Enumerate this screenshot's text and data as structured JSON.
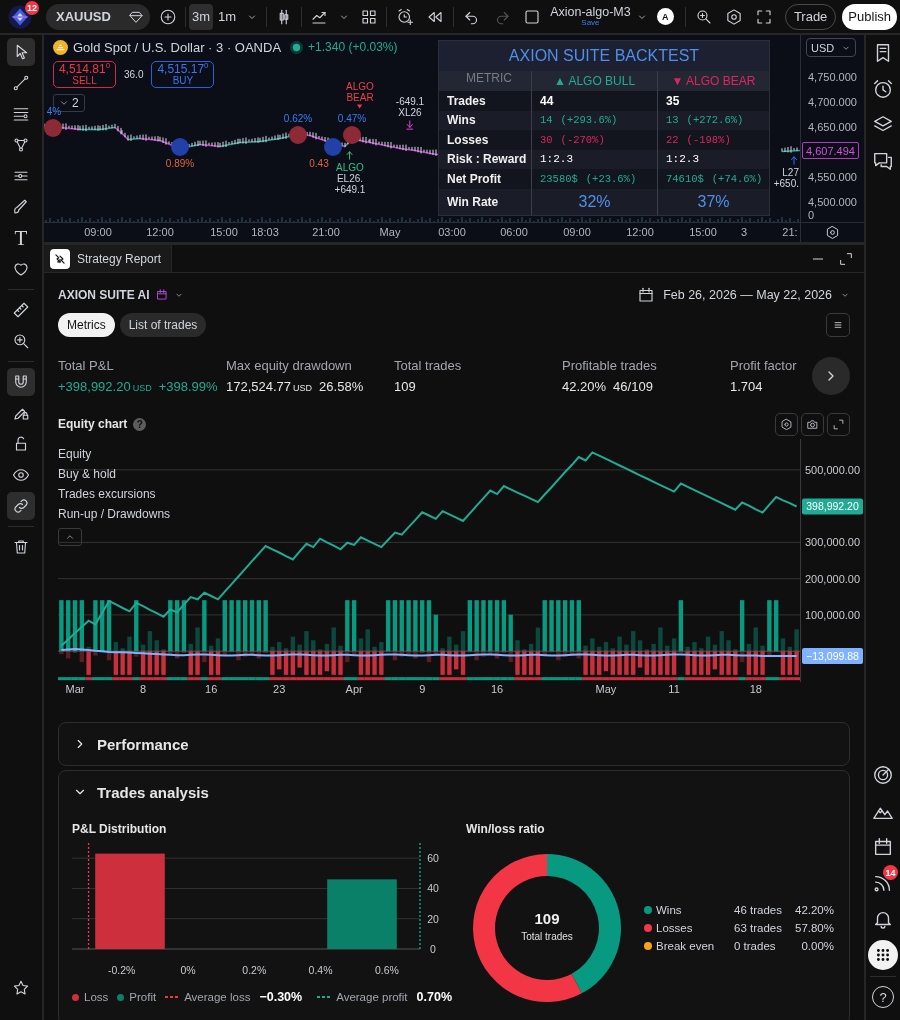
{
  "toolbar": {
    "notifications": "12",
    "symbol": "XAUUSD",
    "intervals": [
      {
        "label": "3m",
        "selected": true
      },
      {
        "label": "1m",
        "selected": false
      }
    ],
    "undo_enabled": true,
    "redo_enabled": false,
    "layout": {
      "name": "Axion-algo-M3",
      "status": "Save"
    },
    "avatar": "A",
    "actions": [
      {
        "label": "Trade",
        "kind": "outline"
      },
      {
        "label": "Publish",
        "kind": "primary"
      }
    ]
  },
  "drawing_tools": [
    {
      "selected": true
    },
    {
      "selected": false
    },
    {
      "selected": false
    },
    {
      "selected": false
    },
    {
      "selected": false
    },
    {
      "selected": false
    },
    {
      "selected": false,
      "glyph": "T"
    },
    {
      "selected": false
    },
    {
      "selected": false
    },
    {
      "selected": false
    },
    {
      "selected": true
    },
    {
      "selected": false
    },
    {
      "selected": false
    },
    {
      "selected": false
    },
    {
      "selected": true
    },
    {
      "selected": false
    },
    {
      "selected": false
    }
  ],
  "side_panel": [
    {
      "selected": false
    },
    {
      "selected": false
    },
    {
      "selected": false
    },
    {
      "selected": false
    },
    {
      "selected": false
    },
    {
      "selected": false
    },
    {
      "selected": false
    },
    {
      "selected": false,
      "badge": "14"
    },
    {
      "selected": false
    },
    {
      "selected": true
    },
    {
      "selected": false,
      "glyph": "?"
    }
  ],
  "chart": {
    "title": "Gold Spot / U.S. Dollar · 3 · OANDA",
    "market_open": true,
    "change": "+1.340 (+0.03%)",
    "sell": {
      "price": "4,514.81$^{0}$",
      "label": "SELL"
    },
    "spread": "36.0",
    "buy": {
      "price": "4,515.17$^{0}$",
      "label": "BUY"
    },
    "studies_count": "2",
    "signals": [
      {
        "kind": "bear",
        "label": "4%"
      },
      {
        "kind": "bull",
        "label": "0.89%"
      },
      {
        "kind": "bear",
        "label": "0.62%"
      },
      {
        "kind": "bull",
        "label": "0.43"
      },
      {
        "kind": "bear",
        "label": "0.47%"
      }
    ],
    "trade_labels": [
      {
        "kind": "bear_entry",
        "lines": [
          {
            "text": "ALGO",
            "kind": "bear"
          },
          {
            "text": "BEAR",
            "kind": "bear"
          }
        ]
      },
      {
        "kind": "bull_entry",
        "lines": [
          {
            "text": "ALGO",
            "kind": "bull"
          },
          {
            "text": "EL26.",
            "kind": "plain"
          },
          {
            "text": "+649.1",
            "kind": "plain"
          }
        ]
      },
      {
        "kind": "exit",
        "lines": [
          {
            "text": "-649.1",
            "kind": "plain"
          },
          {
            "text": "XL26",
            "kind": "plain"
          }
        ]
      },
      {
        "kind": "long_exit",
        "lines": [
          {
            "text": "L27",
            "kind": "plain"
          },
          {
            "text": "+650.",
            "kind": "plain"
          }
        ]
      }
    ],
    "price_axis": {
      "currency": "USD",
      "ticks": [
        "4,750.000",
        "4,700.000",
        "4,650.000",
        "4,550.000",
        "4,500.000",
        "0"
      ],
      "last_price": "4,607.494"
    },
    "time_axis": [
      "09:00",
      "12:00",
      "15:00",
      "18:03",
      "21:00",
      "May",
      "03:00",
      "06:00",
      "09:00",
      "12:00",
      "15:00",
      "3",
      "21:"
    ]
  },
  "backtest": {
    "title": "AXION SUITE BACKTEST",
    "columns": [
      {
        "label": "METRIC",
        "kind": "metric"
      },
      {
        "label": "▲ ALGO BULL",
        "kind": "bull"
      },
      {
        "label": "▼ ALGO BEAR",
        "kind": "bear"
      }
    ],
    "rows": [
      {
        "kind": "plain",
        "cells": [
          [
            "Trades"
          ],
          [
            "44"
          ],
          [
            "35"
          ]
        ]
      },
      {
        "kind": "positive",
        "cells": [
          [
            "Wins"
          ],
          [
            "14",
            "(+293.6%)"
          ],
          [
            "13",
            "(+272.6%)"
          ]
        ]
      },
      {
        "kind": "negative",
        "cells": [
          [
            "Losses"
          ],
          [
            "30",
            "(-270%)"
          ],
          [
            "22",
            "(-198%)"
          ]
        ]
      },
      {
        "kind": "ratio",
        "cells": [
          [
            "Risk : Reward"
          ],
          [
            "1:2.3"
          ],
          [
            "1:2.3"
          ]
        ]
      },
      {
        "kind": "positive",
        "cells": [
          [
            "Net Profit"
          ],
          [
            "23580$",
            "(+23.6%)"
          ],
          [
            "74610$",
            "(+74.6%)"
          ]
        ]
      },
      {
        "kind": "highlight",
        "cells": [
          [
            "Win Rate"
          ],
          [
            "32%"
          ],
          [
            "37%"
          ]
        ]
      }
    ]
  },
  "report": {
    "tab": "Strategy Report",
    "strategy": "AXION SUITE AI",
    "date_range": "Feb 26, 2026 — May 22, 2026",
    "views": [
      {
        "label": "Metrics",
        "selected": true
      },
      {
        "label": "List of trades",
        "selected": false
      }
    ],
    "metrics": [
      {
        "label": "Total P&L",
        "parts": [
          {
            "text": "+398,992.20",
            "kind": "value",
            "positive": true
          },
          {
            "text": "USD",
            "kind": "unit",
            "positive": true
          },
          {
            "text": "+398.99%",
            "kind": "value",
            "positive": true
          }
        ]
      },
      {
        "label": "Max equity drawdown",
        "parts": [
          {
            "text": "172,524.77",
            "kind": "value",
            "positive": false
          },
          {
            "text": "USD",
            "kind": "unit",
            "positive": false
          },
          {
            "text": "26.58%",
            "kind": "value",
            "positive": false
          }
        ]
      },
      {
        "label": "Total trades",
        "parts": [
          {
            "text": "109",
            "kind": "value",
            "positive": false
          }
        ]
      },
      {
        "label": "Profitable trades",
        "parts": [
          {
            "text": "42.20%",
            "kind": "value",
            "positive": false
          },
          {
            "text": "46/109",
            "kind": "value",
            "positive": false
          }
        ]
      },
      {
        "label": "Profit factor",
        "parts": [
          {
            "text": "1.704",
            "kind": "value",
            "positive": false
          }
        ]
      }
    ]
  },
  "equity": {
    "title": "Equity chart",
    "help": "?",
    "legend": [
      "Trades excursions",
      "Run-up / Drawdowns"
    ],
    "legend_expanded": true,
    "tags": [
      "398,992.20",
      "−13,099.88"
    ],
    "chart_data": {
      "type": "line",
      "categories": [
        null,
        null,
        "Mar",
        null,
        null,
        null,
        null,
        null,
        null,
        null,
        null,
        null,
        "8",
        null,
        null,
        null,
        null,
        null,
        null,
        null,
        null,
        null,
        "16",
        null,
        null,
        null,
        null,
        null,
        null,
        null,
        null,
        null,
        "23",
        null,
        null,
        null,
        null,
        null,
        null,
        null,
        null,
        null,
        null,
        "Apr",
        null,
        null,
        null,
        null,
        null,
        null,
        null,
        null,
        null,
        "9",
        null,
        null,
        null,
        null,
        null,
        null,
        null,
        null,
        null,
        null,
        "16",
        null,
        null,
        null,
        null,
        null,
        null,
        null,
        null,
        null,
        null,
        null,
        null,
        null,
        null,
        null,
        "May",
        null,
        null,
        null,
        null,
        null,
        null,
        null,
        null,
        null,
        "11",
        null,
        null,
        null,
        null,
        null,
        null,
        null,
        null,
        null,
        null,
        null,
        "18",
        null,
        null,
        null,
        null,
        null,
        null
      ],
      "series": [
        {
          "name": "Equity",
          "color": "#22ab94",
          "values": [
            15000,
            32000,
            50000,
            67000,
            84000,
            74000,
            106000,
            138000,
            129000,
            119000,
            110000,
            133000,
            124000,
            114000,
            105000,
            95000,
            115000,
            107000,
            128000,
            149000,
            143000,
            161000,
            152000,
            143000,
            164000,
            185000,
            206000,
            227000,
            248000,
            269000,
            290000,
            281000,
            272000,
            262000,
            253000,
            275000,
            296000,
            287000,
            310000,
            300000,
            291000,
            281000,
            299000,
            293000,
            314000,
            305000,
            296000,
            287000,
            307000,
            327000,
            321000,
            342000,
            362000,
            383000,
            374000,
            365000,
            386000,
            377000,
            368000,
            359000,
            380000,
            401000,
            422000,
            443000,
            433000,
            455000,
            446000,
            437000,
            429000,
            420000,
            411000,
            432000,
            452000,
            473000,
            494000,
            514000,
            535000,
            526000,
            548000,
            539000,
            530000,
            521000,
            512000,
            503000,
            494000,
            485000,
            476000,
            467000,
            458000,
            449000,
            440000,
            462000,
            453000,
            444000,
            435000,
            426000,
            417000,
            408000,
            399000,
            390000,
            410000,
            401000,
            391000,
            382000,
            404000,
            425000,
            416000,
            408000,
            399000
          ]
        },
        {
          "name": "Buy & hold",
          "color": "#7fb2ff",
          "values": [
            3000,
            5000,
            6000,
            5000,
            3000,
            1000,
            0,
            -2000,
            -3000,
            -3000,
            -4000,
            -5000,
            -6000,
            -7000,
            -8000,
            -9000,
            -10000,
            -11000,
            -11000,
            -10000,
            -9000,
            -9000,
            -10000,
            -11000,
            -12000,
            -12000,
            -11000,
            -10000,
            -10000,
            -11000,
            -12000,
            -12000,
            -11000,
            -10000,
            -9000,
            -9000,
            -10000,
            -11000,
            -12000,
            -12000,
            -11000,
            -10000,
            -10000,
            -11000,
            -12000,
            -12000,
            -11000,
            -10000,
            -9000,
            -9000,
            -10000,
            -11000,
            -12000,
            -12000,
            -11000,
            -10000,
            -10000,
            -11000,
            -12000,
            -12000,
            -11000,
            -10000,
            -9000,
            -9000,
            -10000,
            -11000,
            -12000,
            -12000,
            -11000,
            -10000,
            -10000,
            -11000,
            -12000,
            -12000,
            -11000,
            -10000,
            -9000,
            -9000,
            -10000,
            -11000,
            -12000,
            -12000,
            -11000,
            -10000,
            -10000,
            -11000,
            -12000,
            -12000,
            -11000,
            -10000,
            -9000,
            -9000,
            -10000,
            -11000,
            -12000,
            -12000,
            -11000,
            -10000,
            -10000,
            -11000,
            -12000,
            -12000,
            -12000,
            -13000,
            -13000,
            -13000,
            -13000,
            -13000,
            -13000
          ]
        }
      ],
      "ylim": [
        -85000,
        585000
      ],
      "yticks": [
        {
          "value": 100000,
          "label": "100,000.00"
        },
        {
          "value": 200000,
          "label": "200,000.00"
        },
        {
          "value": 300000,
          "label": "300,000.00"
        },
        {
          "value": 500000,
          "label": "500,000.00"
        }
      ],
      "grid": true
    }
  },
  "sections": [
    {
      "title": "Performance",
      "expanded": false
    },
    {
      "title": "Trades analysis",
      "expanded": true,
      "pnl": {
        "title": "P&L Distribution",
        "chart_data": {
          "type": "bar",
          "x": [
            -0.175,
            0.525
          ],
          "series": [
            {
              "name": "Loss",
              "color": "#cd2f3d",
              "values": [
                63,
                null
              ]
            },
            {
              "name": "Profit",
              "color": "#0b8068",
              "values": [
                null,
                46
              ]
            }
          ],
          "xlim": [
            -0.35,
            0.7
          ],
          "ylim": [
            0,
            70
          ],
          "xticks": [
            {
              "value": -0.2,
              "label": "-0.2%"
            },
            {
              "value": 0,
              "label": "0%"
            },
            {
              "value": 0.2,
              "label": "0.2%"
            },
            {
              "value": 0.4,
              "label": "0.4%"
            },
            {
              "value": 0.6,
              "label": "0.6%"
            }
          ],
          "yticks": [
            0,
            20,
            40,
            60
          ],
          "grid": true,
          "ref_lines": [
            {
              "axis": "x",
              "value": -0.3
            },
            {
              "axis": "x",
              "value": 0.7
            }
          ]
        },
        "legend": [
          {
            "label": "Average loss",
            "value": "−0.30%",
            "color": "#f23645"
          },
          {
            "label": "Average profit",
            "value": "0.70%",
            "color": "#22ab94"
          }
        ]
      },
      "ratio": {
        "title": "Win/loss ratio",
        "total": "109",
        "total_label": "Total trades",
        "chart_data": {
          "type": "donut",
          "categories": [
            "Wins",
            "Losses",
            "Break even"
          ],
          "values": [
            42.2,
            57.8,
            0
          ]
        },
        "legend": [
          {
            "count": "46 trades",
            "share": "42.20%",
            "color": "#089981"
          },
          {
            "count": "63 trades",
            "share": "57.80%",
            "color": "#f23645"
          },
          {
            "count": "0 trades",
            "share": "0.00%",
            "color": "#f7a21b"
          }
        ]
      }
    }
  ]
}
